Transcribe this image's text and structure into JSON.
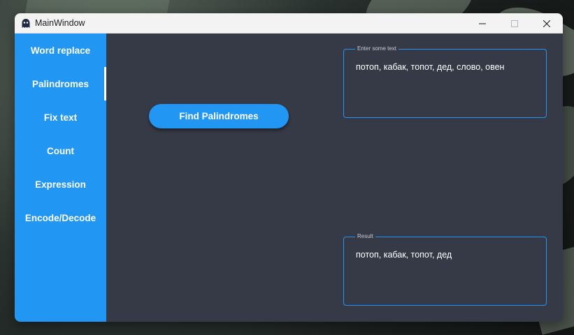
{
  "window": {
    "title": "MainWindow",
    "icon": "ghost-icon"
  },
  "sidebar": {
    "items": [
      {
        "label": "Word replace",
        "active": false
      },
      {
        "label": "Palindromes",
        "active": true
      },
      {
        "label": "Fix text",
        "active": false
      },
      {
        "label": "Count",
        "active": false
      },
      {
        "label": "Expression",
        "active": false
      },
      {
        "label": "Encode/Decode",
        "active": false
      }
    ]
  },
  "main": {
    "action_button": "Find Palindromes",
    "input": {
      "label": "Enter some text",
      "value": "потоп, кабак, топот, дед, слово, овен"
    },
    "result": {
      "label": "Result",
      "value": "потоп, кабак, топот, дед"
    }
  },
  "colors": {
    "accent": "#2196f3",
    "content_bg": "#363a47",
    "titlebar_bg": "#f3f3f3"
  }
}
